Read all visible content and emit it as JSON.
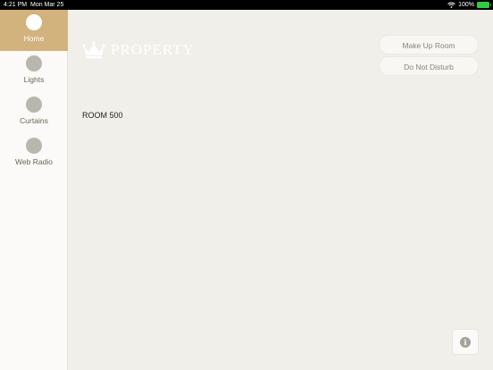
{
  "status_bar": {
    "time": "4:21 PM",
    "date": "Mon Mar 25",
    "battery_percent": "100%",
    "battery_level": 1.0
  },
  "sidebar": {
    "items": [
      {
        "label": "Home",
        "icon": "home-icon",
        "active": true
      },
      {
        "label": "Lights",
        "icon": "lights-icon",
        "active": false
      },
      {
        "label": "Curtains",
        "icon": "curtains-icon",
        "active": false
      },
      {
        "label": "Web Radio",
        "icon": "web-radio-icon",
        "active": false
      }
    ]
  },
  "header": {
    "brand": "PROPERTY",
    "logo_icon": "crown-icon"
  },
  "actions": {
    "make_up_room": "Make Up Room",
    "do_not_disturb": "Do Not Disturb"
  },
  "main": {
    "room": "ROOM 500"
  },
  "info": {
    "glyph": "i",
    "icon": "info-icon"
  },
  "colors": {
    "accent": "#d2b27d",
    "background": "#f1efe9",
    "sidebar": "#fbfaf8"
  }
}
